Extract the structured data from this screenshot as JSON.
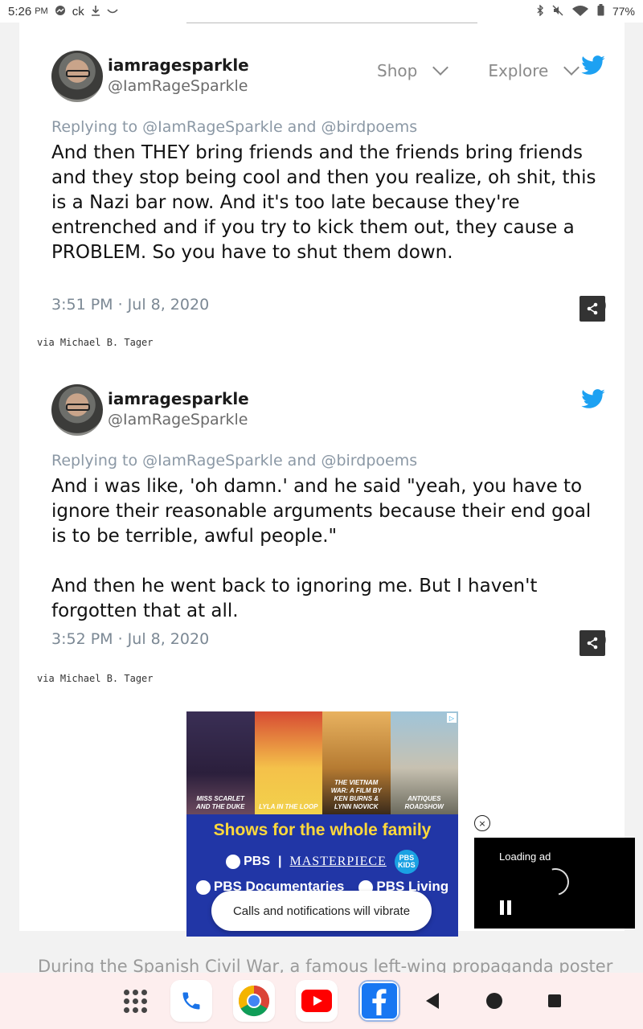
{
  "status_bar": {
    "time": "5:26",
    "ampm": "PM",
    "carrier": "ck",
    "battery": "77%"
  },
  "nav": {
    "items": [
      {
        "label": "Shop"
      },
      {
        "label": "Explore"
      }
    ]
  },
  "tweets": [
    {
      "name": "iamragesparkle",
      "handle": "@IamRageSparkle",
      "reply": "Replying to @IamRageSparkle and @birdpoems",
      "body": "And then THEY bring friends and the friends bring friends and they stop being cool and then you realize, oh shit, this is a Nazi bar now. And it's too late because they're entrenched and if you try to kick them out, they cause a PROBLEM. So you have to shut them down.",
      "time": "3:51 PM · Jul 8, 2020",
      "via": "via Michael B. Tager"
    },
    {
      "name": "iamragesparkle",
      "handle": "@IamRageSparkle",
      "reply": "Replying to @IamRageSparkle and @birdpoems",
      "body": "And i was like, 'oh damn.' and he said \"yeah, you have to ignore their reasonable arguments because their end goal is to be terrible, awful people.\"\n\nAnd then he went back to ignoring me. But I haven't forgotten that at all.",
      "time": "3:52 PM · Jul 8, 2020",
      "via": "via Michael B. Tager"
    }
  ],
  "ad": {
    "panels": [
      "MISS SCARLET AND THE DUKE",
      "LYLA IN THE LOOP",
      "THE VIETNAM WAR: A FILM BY KEN BURNS & LYNN NOVICK",
      "ANTIQUES ROADSHOW"
    ],
    "headline": "Shows for the whole family",
    "logo_pbs": "PBS",
    "logo_masterpiece": "MASTERPIECE",
    "logo_kids": "PBS KIDS",
    "logo_docs": "PBS Documentaries",
    "logo_living": "PBS Living",
    "close_label": "×"
  },
  "video_ad": {
    "loading_label": "Loading ad"
  },
  "toast": {
    "message": "Calls and notifications will vibrate"
  },
  "article": {
    "next_line": "During the Spanish Civil War, a famous left-wing propaganda poster"
  },
  "colors": {
    "twitter_blue": "#1da1f2",
    "ad_blue": "#2136a6",
    "ad_yellow": "#ffd93b",
    "dock_bg": "#fdeeee"
  },
  "dock": {
    "apps": [
      "app-drawer-icon",
      "phone-icon",
      "chrome-icon",
      "youtube-icon",
      "facebook-icon"
    ],
    "nav": [
      "back-icon",
      "home-icon",
      "recents-icon"
    ]
  }
}
